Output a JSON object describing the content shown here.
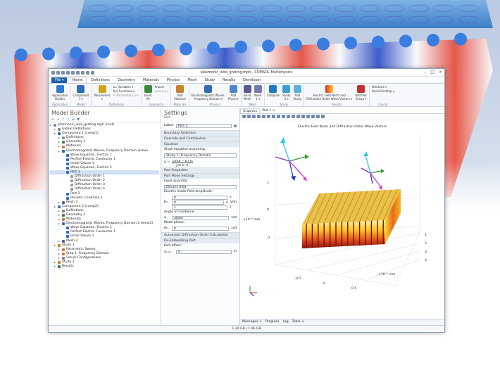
{
  "window": {
    "title": "plasmonic_wire_grating.mph - COMSOL Multiphysics"
  },
  "ribbon_tabs": [
    "File ▾",
    "Home",
    "Definitions",
    "Geometry",
    "Materials",
    "Physics",
    "Mesh",
    "Study",
    "Results",
    "Developer"
  ],
  "ribbon": {
    "application_builder": "Application\nBuilder",
    "application": "Application",
    "component": "Component\n1 ▾",
    "model": "Model",
    "parameters": "Parameters\n▾",
    "variables": "a= Variables ▾",
    "functions": "f(x) Functions ▾",
    "parameter_case": "P₁ Parameter Case",
    "definitions": "Definitions",
    "build_all": "Build\nAll",
    "import": "Import",
    "livelink": "LiveLink ▾",
    "geometry": "Geometry",
    "add_material": "Add\nMaterial",
    "materials": "Materials",
    "emw": "Electromagnetic Waves,\nFrequency Domain ▾",
    "add_physics": "Add\nPhysics",
    "physics": "Physics",
    "build_mesh": "Build\nMesh",
    "mesh1": "Mesh\n1 ▾",
    "mesh": "Mesh",
    "compute": "Compute",
    "study2": "Study\n2 ▾",
    "add_study": "Add\nStudy",
    "study": "Study",
    "efield": "Electric Field Norm and\nDiffraction Order Wave Vectors ▾",
    "add_plot": "Add Plot\nGroup ▾",
    "results": "Results",
    "windows": "Windows ▾",
    "reset_desktop": "Reset Desktop ▾",
    "layout": "Layout"
  },
  "model_builder": {
    "title": "Model Builder",
    "tree": [
      {
        "label": "plasmonic_wire_grating.mph (root)",
        "d": 0,
        "c": "#6b8cba"
      },
      {
        "label": "Global Definitions",
        "d": 1,
        "c": "#8a8a8a"
      },
      {
        "label": "Component 1 (comp1)",
        "d": 1,
        "c": "#2f6db3"
      },
      {
        "label": "Definitions",
        "d": 2,
        "c": "#888"
      },
      {
        "label": "Geometry 1",
        "d": 2,
        "c": "#3a8a3a"
      },
      {
        "label": "Materials",
        "d": 2,
        "c": "#c9832b"
      },
      {
        "label": "Electromagnetic Waves, Frequency Domain (emw)",
        "d": 2,
        "c": "#2f6db3"
      },
      {
        "label": "Wave Equation, Electric 1",
        "d": 3,
        "c": "#2f6db3"
      },
      {
        "label": "Perfect Electric Conductor 1",
        "d": 3,
        "c": "#2f6db3"
      },
      {
        "label": "Initial Values 1",
        "d": 3,
        "c": "#2f6db3"
      },
      {
        "label": "Wave Equation, Electric 2",
        "d": 3,
        "c": "#2f6db3"
      },
      {
        "label": "Port 1",
        "d": 3,
        "c": "#2f6db3",
        "sel": true
      },
      {
        "label": "Diffraction Order 1",
        "d": 4,
        "c": "#999"
      },
      {
        "label": "Diffraction Order 2",
        "d": 4,
        "c": "#999"
      },
      {
        "label": "Diffraction Order 3",
        "d": 4,
        "c": "#999"
      },
      {
        "label": "Diffraction Order 4",
        "d": 4,
        "c": "#999"
      },
      {
        "label": "Port 2",
        "d": 3,
        "c": "#2f6db3"
      },
      {
        "label": "Periodic Condition 1",
        "d": 3,
        "c": "#2f6db3"
      },
      {
        "label": "Mesh 1",
        "d": 2,
        "c": "#5a5a9a"
      },
      {
        "label": "Component 2 (comp2)",
        "d": 1,
        "c": "#2f6db3"
      },
      {
        "label": "Definitions",
        "d": 2,
        "c": "#888"
      },
      {
        "label": "Geometry 2",
        "d": 2,
        "c": "#3a8a3a"
      },
      {
        "label": "Materials",
        "d": 2,
        "c": "#c9832b"
      },
      {
        "label": "Electromagnetic Waves, Frequency Domain 2 (emw2)",
        "d": 2,
        "c": "#2f6db3"
      },
      {
        "label": "Wave Equation, Electric 1",
        "d": 3,
        "c": "#2f6db3"
      },
      {
        "label": "Perfect Electric Conductor 1",
        "d": 3,
        "c": "#2f6db3"
      },
      {
        "label": "Initial Values 1",
        "d": 3,
        "c": "#2f6db3"
      },
      {
        "label": "Mesh 2",
        "d": 2,
        "c": "#5a5a9a"
      },
      {
        "label": "Study 1",
        "d": 1,
        "c": "#d07a2a"
      },
      {
        "label": "Parametric Sweep",
        "d": 2,
        "c": "#d07a2a"
      },
      {
        "label": "Step 1: Frequency Domain",
        "d": 2,
        "c": "#d07a2a"
      },
      {
        "label": "Solver Configurations",
        "d": 2,
        "c": "#888"
      },
      {
        "label": "Study 2",
        "d": 1,
        "c": "#d07a2a"
      },
      {
        "label": "Results",
        "d": 1,
        "c": "#3d7d3d"
      }
    ]
  },
  "settings": {
    "title": "Settings",
    "subtitle": "Port",
    "label_caption": "Label:",
    "label_value": "Port 1",
    "sec_boundary": "Boundary Selection",
    "sec_override": "Override and Contribution",
    "sec_equation": "Equation",
    "show_eq": "Show equation assuming:",
    "study_value": "Study 1, Frequency Domain",
    "eq_s": "S =",
    "eq_num": "∫∂Ω(E − E₁)·E₁",
    "eq_den": "∫∂Ω E₁·E₁",
    "sec_port_props": "Port Properties",
    "sec_port_mode": "Port Mode Settings",
    "input_qty": "Input quantity:",
    "input_value": "Electric field",
    "e_amp": "Electric mode field amplitude:",
    "e_sym": "E₀",
    "e0x": "0",
    "e0y": "0",
    "e0z": "1",
    "ax_x": "x",
    "ax_y": "y",
    "ax_z": "z",
    "e_unit": "V/m",
    "angle_lbl": "Angle of incidence:",
    "alpha_sym": "α",
    "alpha_val": "alpha",
    "rad": "rad",
    "mode_phase": "Mode phase:",
    "theta_sym": "θ₀",
    "theta_val": "0",
    "sec_auto": "Automatic Diffraction Order Calculation",
    "sec_deemb": "De-Embedding Port",
    "port_offset": "Port offset:",
    "doff_sym": "dₒₒₛₑₜ",
    "doff_val": "0",
    "m": "m"
  },
  "graphics": {
    "tab_graphics": "Graphics",
    "tab_plot": "Plot 1 ×",
    "plot_title": "Electric Field Norm and Diffraction Order Wave Vectors",
    "yticks": [
      "1",
      "0",
      "-1"
    ],
    "yexp": "×10⁻⁶ mm",
    "xticks": [
      "1",
      "2",
      "3",
      "4"
    ],
    "zexp": "×10⁻⁶ mm",
    "zticks": [
      "-0.5",
      "0",
      "0.5"
    ]
  },
  "bottom_tabs": [
    "Messages ×",
    "Progress",
    "Log",
    "Table ×"
  ],
  "status": "1.34 GB | 1.66 GB"
}
